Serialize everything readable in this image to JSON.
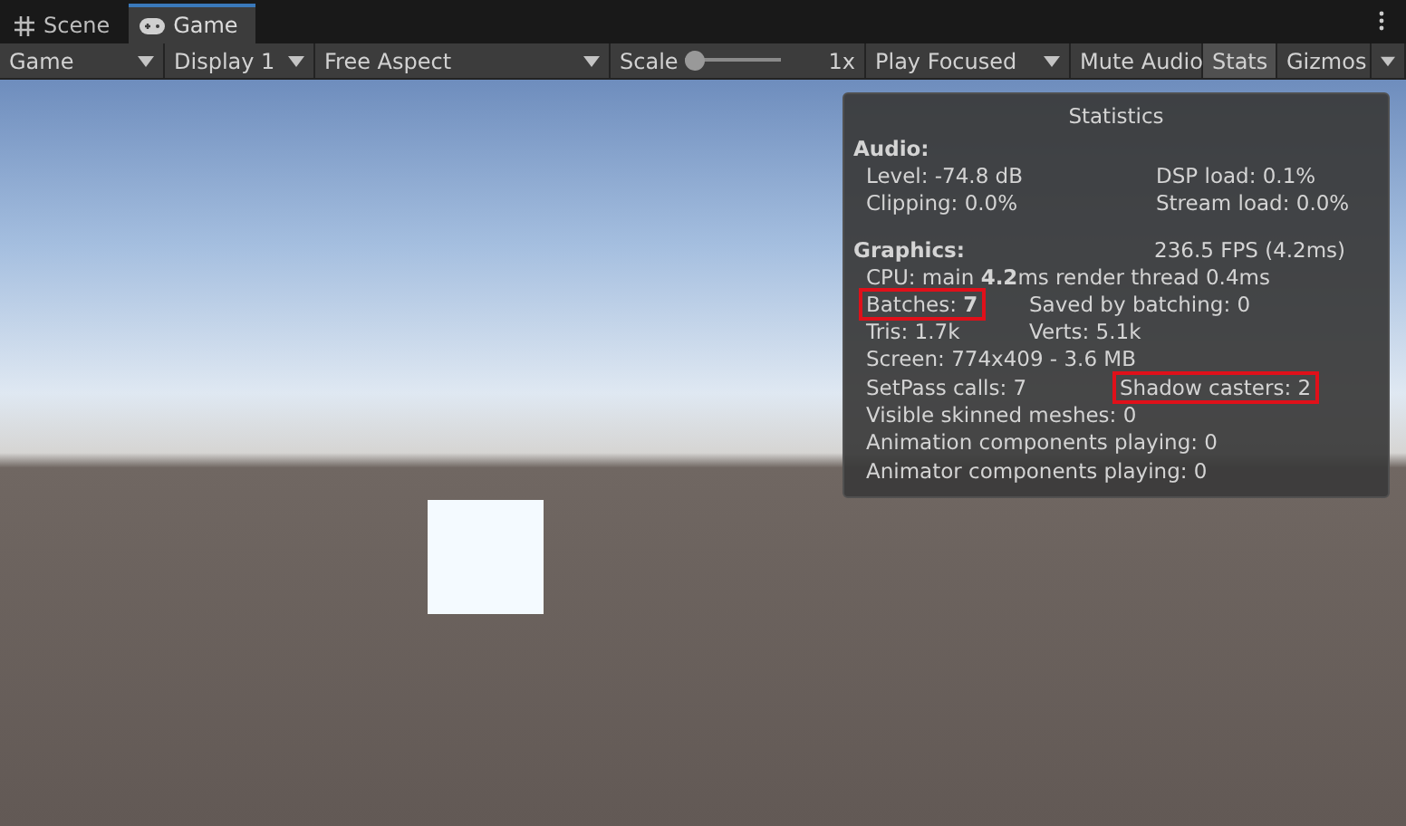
{
  "tabs": [
    {
      "label": "Scene",
      "selected": false
    },
    {
      "label": "Game",
      "selected": true
    }
  ],
  "toolbar": [
    {
      "kind": "dropdown",
      "label": "Game",
      "selected": false
    },
    {
      "kind": "dropdown",
      "label": "Display 1",
      "selected": false
    },
    {
      "kind": "dropdown",
      "label": "Free Aspect",
      "selected": false
    },
    {
      "kind": "slider",
      "label": "Scale",
      "level": 0.0,
      "reading": "1x"
    },
    {
      "kind": "dropdown",
      "label": "Play Focused",
      "selected": false
    },
    {
      "kind": "toggle",
      "label": "Mute Audio",
      "selected": false
    },
    {
      "kind": "toggle",
      "label": "Stats",
      "selected": true
    },
    {
      "kind": "split",
      "label": "Gizmos",
      "selected": false
    }
  ],
  "statistics": {
    "title": "Statistics",
    "sections": [
      {
        "heading": "Audio:",
        "rows": [
          {
            "kind": "wide",
            "cells": [
              {
                "text": "Level: -74.8 dB",
                "highlighted": false
              },
              {
                "text": "DSP load: 0.1%",
                "highlighted": false
              }
            ]
          },
          {
            "kind": "wide",
            "cells": [
              {
                "text": "Clipping: 0.0%",
                "highlighted": false
              },
              {
                "text": "Stream load: 0.0%",
                "highlighted": false
              }
            ]
          }
        ]
      },
      {
        "heading": "Graphics:",
        "heading_right": "236.5 FPS (4.2ms)",
        "rows": [
          {
            "kind": "single",
            "cells": [
              {
                "text": "CPU: main **4.2**ms  render thread 0.4ms",
                "highlighted": false
              }
            ]
          },
          {
            "kind": "narrow",
            "cells": [
              {
                "text": "Batches: **7**",
                "highlighted": true
              },
              {
                "text": "Saved by batching: 0",
                "highlighted": false
              }
            ]
          },
          {
            "kind": "narrow",
            "cells": [
              {
                "text": "Tris: 1.7k",
                "highlighted": false
              },
              {
                "text": "Verts: 5.1k",
                "highlighted": false
              }
            ]
          },
          {
            "kind": "single",
            "cells": [
              {
                "text": "Screen: 774x409 - 3.6 MB",
                "highlighted": false
              }
            ]
          },
          {
            "kind": "medium",
            "cells": [
              {
                "text": "SetPass calls: 7",
                "highlighted": false
              },
              {
                "text": "Shadow casters: 2",
                "highlighted": true
              }
            ]
          },
          {
            "kind": "single",
            "cells": [
              {
                "text": "Visible skinned meshes: 0",
                "highlighted": false
              }
            ]
          },
          {
            "kind": "single",
            "cells": [
              {
                "text": "Animation components playing: 0",
                "highlighted": false
              }
            ]
          },
          {
            "kind": "single",
            "cells": [
              {
                "text": "Animator components playing: 0",
                "highlighted": false
              }
            ]
          }
        ]
      }
    ]
  }
}
